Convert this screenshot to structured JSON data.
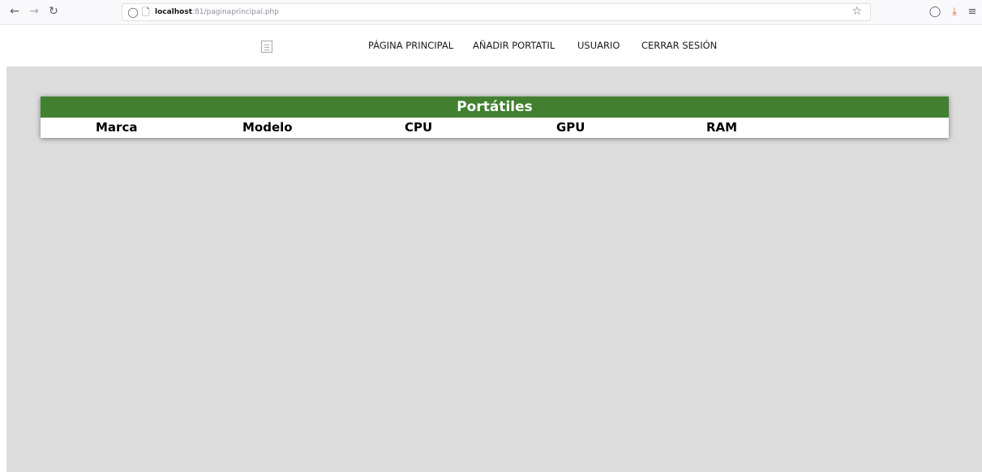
{
  "browser": {
    "url_host": "localhost",
    "url_rest": ":81/paginaprincipal.php",
    "back_icon": "arrow-left-icon",
    "forward_icon": "arrow-right-icon",
    "reload_icon": "reload-icon",
    "shield_icon": "shield-icon",
    "page_icon": "page-icon",
    "bookmark_icon": "star-icon",
    "pocket_icon": "pocket-icon",
    "download_icon": "download-icon",
    "menu_icon": "hamburger-menu-icon",
    "download_color": "#e8622e"
  },
  "header": {
    "nav": [
      "PÁGINA PRINCIPAL",
      "AÑADIR PORTATIL",
      "USUARIO",
      "CERRAR SESIÓN"
    ]
  },
  "table": {
    "caption": "Portátiles",
    "columns": [
      "Marca",
      "Modelo",
      "CPU",
      "GPU",
      "RAM"
    ],
    "caption_color": "#428030"
  },
  "main": {
    "background": "#dcdcdc"
  }
}
